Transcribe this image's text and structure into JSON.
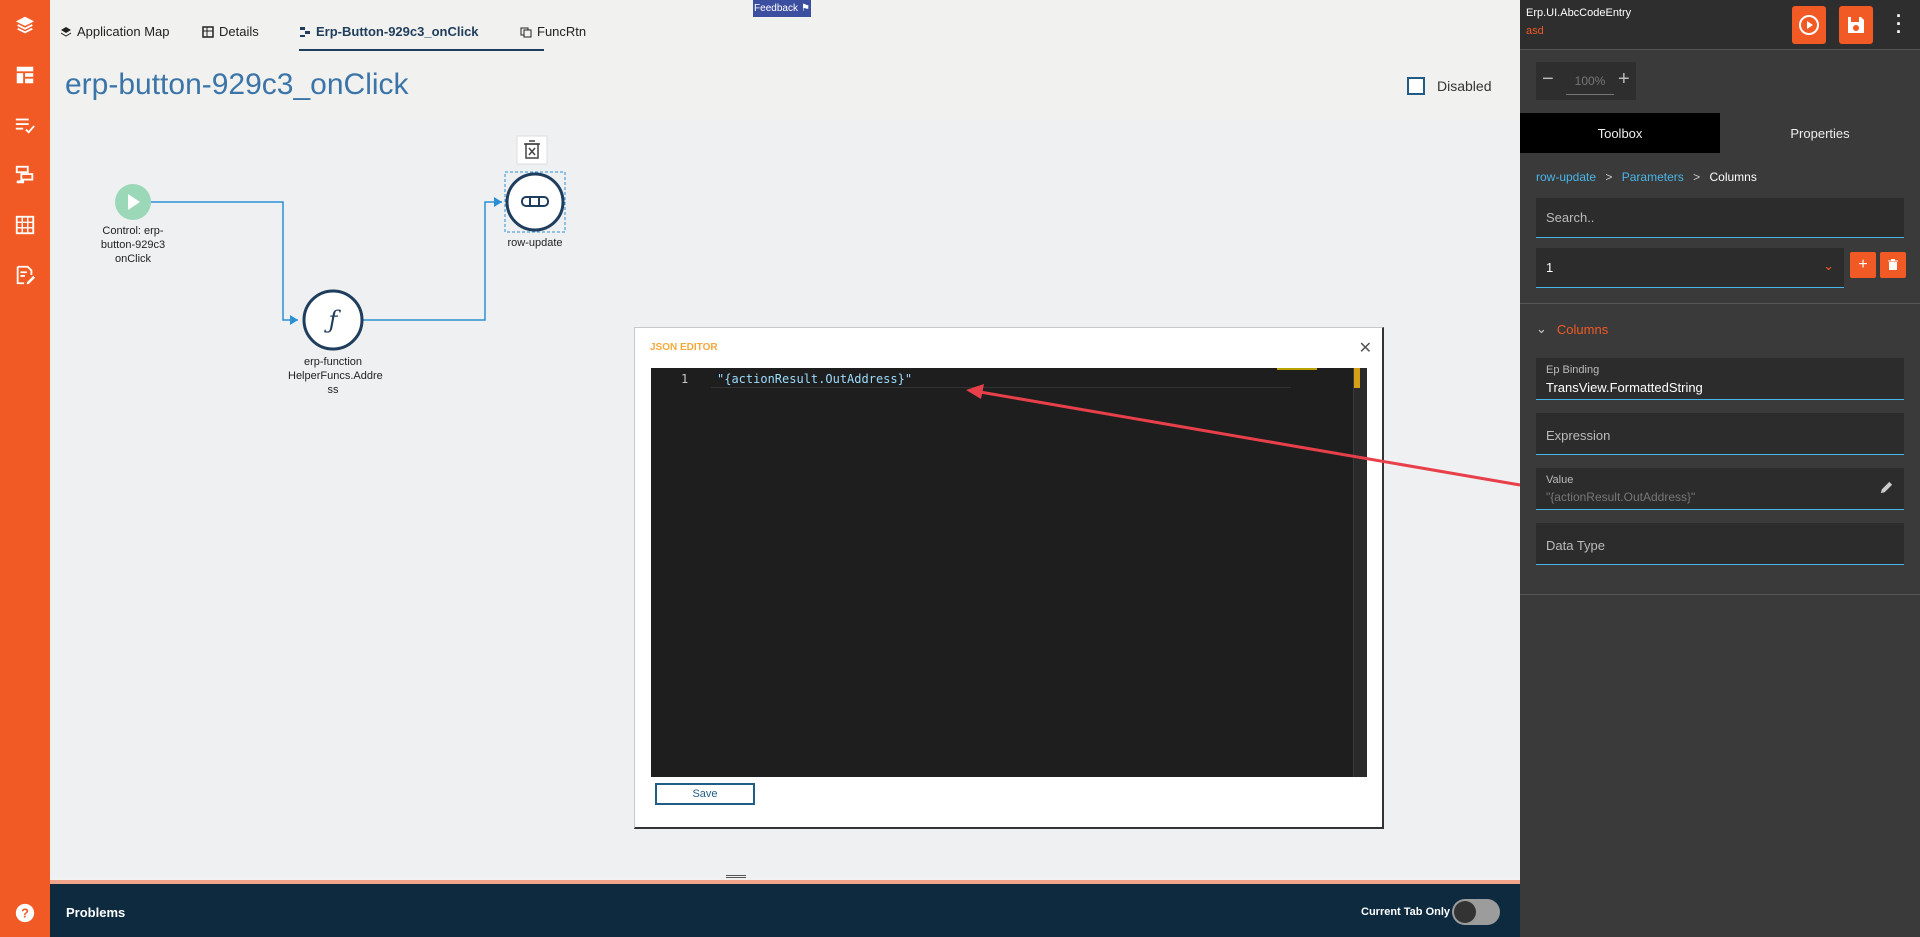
{
  "tabs": [
    {
      "label": "Application Map",
      "icon": "layers-icon"
    },
    {
      "label": "Details",
      "icon": "table-icon"
    },
    {
      "label": "Erp-Button-929c3_onClick",
      "icon": "flow-icon"
    },
    {
      "label": "FuncRtn",
      "icon": "copy-icon"
    }
  ],
  "feedback_label": "Feedback",
  "page": {
    "title": "erp-button-929c3_onClick",
    "disabled_label": "Disabled"
  },
  "flow": {
    "start_label": "Control: erp-\nbutton-929c3\nonClick",
    "function_label": "erp-function\nHelperFuncs.Addre\nss",
    "function_glyph": "ƒ",
    "action_label": "row-update"
  },
  "json_editor": {
    "title": "JSON EDITOR",
    "close": "✕",
    "line_number": "1",
    "code": "\"{actionResult.OutAddress}\"",
    "save_label": "Save"
  },
  "problems": {
    "label": "Problems",
    "current_tab_only": "Current Tab Only"
  },
  "right_panel": {
    "title": "Erp.UI.AbcCodeEntry",
    "subtitle": "asd",
    "zoom": {
      "minus": "−",
      "value": "100%",
      "plus": "+"
    },
    "tabs": [
      "Toolbox",
      "Properties"
    ],
    "breadcrumb": {
      "item1": "row-update",
      "item2": "Parameters",
      "current": "Columns",
      "sep": ">"
    },
    "search_placeholder": "Search..",
    "select_value": "1",
    "section_title": "Columns",
    "fields": {
      "ep_binding_label": "Ep Binding",
      "ep_binding_value": "TransView.FormattedString",
      "expression_label": "Expression",
      "value_label": "Value",
      "value_value": "\"{actionResult.OutAddress}\"",
      "data_type_label": "Data Type"
    }
  },
  "colors": {
    "accent": "#f15a24",
    "link": "#4ab5e8",
    "title_blue": "#3b74a8",
    "node_dark": "#1f3d5c",
    "arrow_red": "#e8404a"
  }
}
